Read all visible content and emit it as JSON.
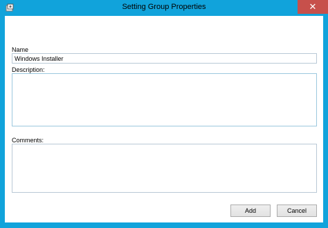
{
  "window": {
    "title": "Setting Group Properties",
    "close_label": "✕",
    "icon": "settings-group-icon"
  },
  "form": {
    "name_label": "Name",
    "name_value": "Windows Installer",
    "description_label": "Description:",
    "description_value": "",
    "comments_label": "Comments:",
    "comments_value": ""
  },
  "buttons": {
    "add_label": "Add",
    "cancel_label": "Cancel"
  },
  "colors": {
    "title_bar": "#11a3db",
    "close_button": "#c7504b"
  }
}
